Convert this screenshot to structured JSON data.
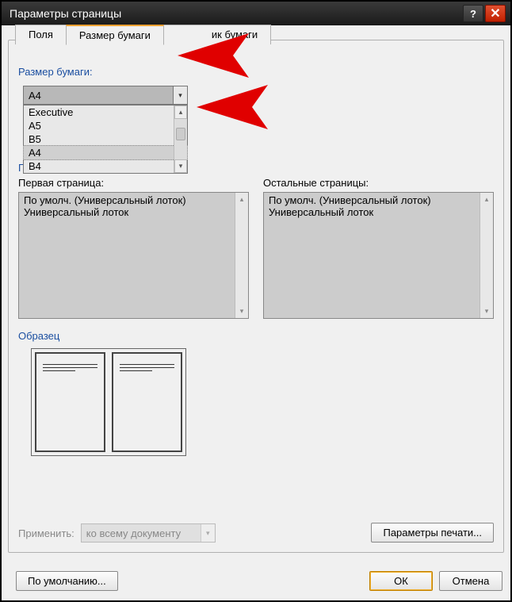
{
  "window": {
    "title": "Параметры страницы"
  },
  "tabs": {
    "fields": "Поля",
    "paper_size": "Размер бумаги",
    "paper_source_partial": "ик бумаги"
  },
  "paper_size_section": {
    "label": "Размер бумаги:",
    "selected": "A4",
    "options": [
      "Executive",
      "A5",
      "B5",
      "A4",
      "B4"
    ]
  },
  "partial_label_under_dropdown": "П",
  "sources": {
    "first_label": "Первая страница:",
    "other_label": "Остальные страницы:",
    "first_items": [
      "По умолч. (Универсальный лоток)",
      "Универсальный лоток"
    ],
    "other_items": [
      "По умолч. (Универсальный лоток)",
      "Универсальный лоток"
    ]
  },
  "sample": {
    "label": "Образец"
  },
  "apply": {
    "label": "Применить:",
    "value": "ко всему документу"
  },
  "buttons": {
    "print_options": "Параметры печати...",
    "default": "По умолчанию...",
    "ok": "ОК",
    "cancel": "Отмена"
  }
}
